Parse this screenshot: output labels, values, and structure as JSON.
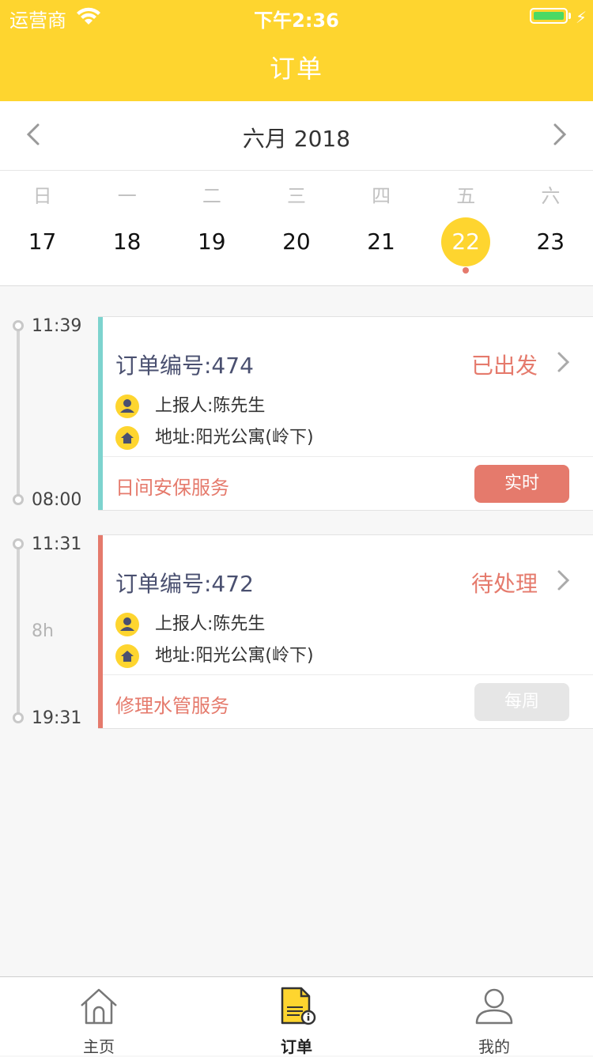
{
  "status_bar": {
    "carrier": "运营商",
    "time": "下午2:36"
  },
  "header": {
    "title": "订单"
  },
  "calendar": {
    "month_label": "六月 2018",
    "weekdays": [
      "日",
      "一",
      "二",
      "三",
      "四",
      "五",
      "六"
    ],
    "dates": [
      "17",
      "18",
      "19",
      "20",
      "21",
      "22",
      "23"
    ],
    "selected_date": "22"
  },
  "orders": [
    {
      "start_time": "11:39",
      "end_time": "08:00",
      "duration": "",
      "order_no": "订单编号:474",
      "status": "已出发",
      "reporter": "上报人:陈先生",
      "address": "地址:阳光公寓(岭下)",
      "service": "日间安保服务",
      "tag": "实时",
      "accent_color": "#7dd3ce",
      "tag_color": "#e57a6c"
    },
    {
      "start_time": "11:31",
      "end_time": "19:31",
      "duration": "8h",
      "order_no": "订单编号:472",
      "status": "待处理",
      "reporter": "上报人:陈先生",
      "address": "地址:阳光公寓(岭下)",
      "service": "修理水管服务",
      "tag": "每周",
      "accent_color": "#e57a6c",
      "tag_color": "#e6e6e6"
    }
  ],
  "tabbar": {
    "items": [
      {
        "label": "主页",
        "icon": "home-icon"
      },
      {
        "label": "订单",
        "icon": "order-icon"
      },
      {
        "label": "我的",
        "icon": "profile-icon"
      }
    ]
  },
  "colors": {
    "brand_yellow": "#fed52f",
    "accent_red": "#e57a6c"
  }
}
